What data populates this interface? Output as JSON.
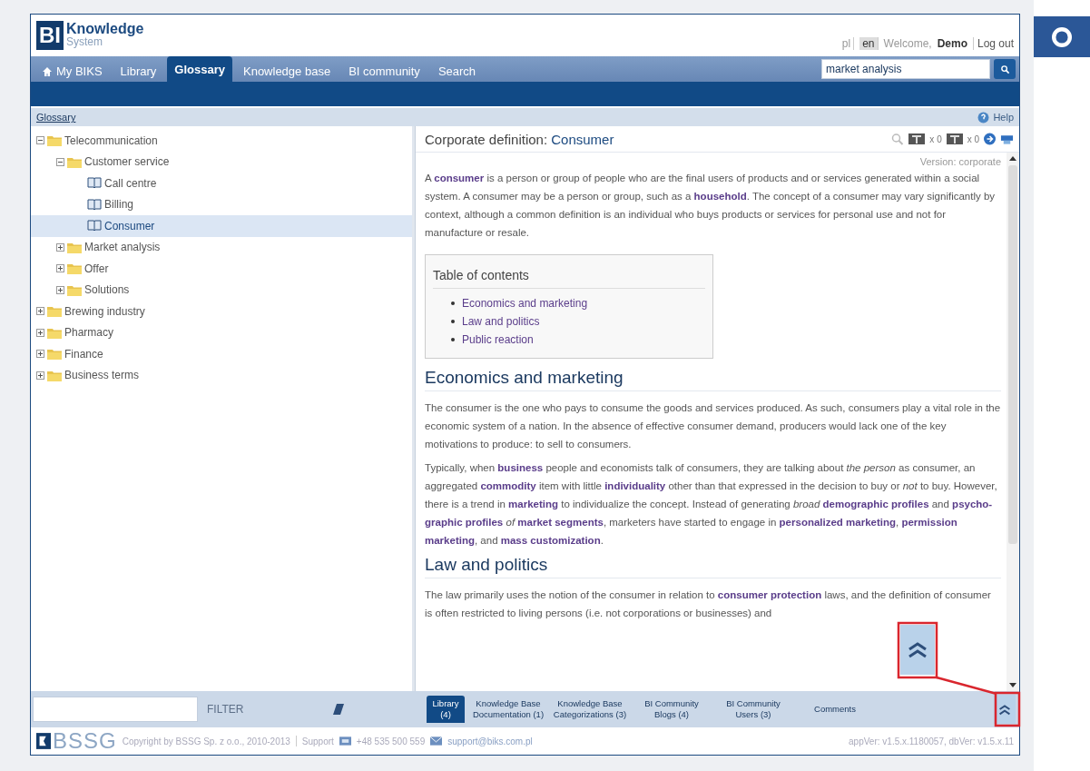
{
  "header": {
    "logo_mark": "BI",
    "logo_title": "Knowledge",
    "logo_subtitle": "System",
    "languages": [
      {
        "label": "pl",
        "selected": false
      },
      {
        "label": "en",
        "selected": true
      }
    ],
    "welcome": "Welcome,",
    "user": "Demo",
    "logout": "Log out"
  },
  "nav_tabs": [
    {
      "label": "My BIKS",
      "selected": false,
      "home": true
    },
    {
      "label": "Library",
      "selected": false
    },
    {
      "label": "Glossary",
      "selected": true
    },
    {
      "label": "Knowledge base",
      "selected": false
    },
    {
      "label": "BI community",
      "selected": false
    },
    {
      "label": "Search",
      "selected": false
    }
  ],
  "search": {
    "value": "market analysis"
  },
  "breadcrumb": "Glossary",
  "help": "Help",
  "tree": [
    {
      "label": "Telecommunication",
      "kind": "folder",
      "expanded": true,
      "selected": false,
      "children": [
        {
          "label": "Customer service",
          "kind": "folder",
          "expanded": true,
          "selected": false,
          "children": [
            {
              "label": "Call centre",
              "kind": "term",
              "selected": false
            },
            {
              "label": "Billing",
              "kind": "term",
              "selected": false
            },
            {
              "label": "Consumer",
              "kind": "term",
              "selected": true
            }
          ]
        },
        {
          "label": "Market analysis",
          "kind": "folder",
          "expanded": false,
          "selected": false
        },
        {
          "label": "Offer",
          "kind": "folder",
          "expanded": false,
          "selected": false
        },
        {
          "label": "Solutions",
          "kind": "folder",
          "expanded": false,
          "selected": false
        }
      ]
    },
    {
      "label": "Brewing industry",
      "kind": "folder",
      "expanded": false,
      "selected": false
    },
    {
      "label": "Pharmacy",
      "kind": "folder",
      "expanded": false,
      "selected": false
    },
    {
      "label": "Finance",
      "kind": "folder",
      "expanded": false,
      "selected": false
    },
    {
      "label": "Business terms",
      "kind": "folder",
      "expanded": false,
      "selected": false
    }
  ],
  "article": {
    "title_prefix": "Corporate definition:",
    "title": "Consumer",
    "counters": [
      "x 0",
      "x 0"
    ],
    "version": "Version: corporate",
    "intro": "A **consumer** is a person or group of people who are the final users of products and or services generated within a social system. A consumer may be a person or group, such as a **household**. The concept of a consumer may vary significantly by context, although a common definition is an individual who buys products or services for personal use and not for manufacture or resale.",
    "toc_title": "Table of contents",
    "toc": [
      "Economics and marketing",
      "Law and politics",
      "Public reaction"
    ],
    "sections": [
      {
        "heading": "Economics and marketing",
        "paragraphs": [
          "The consumer is the one who pays to consume the goods and services produced. As such, consumers play a vital role in the economic system of a nation. In the absence of effective consumer demand, producers would lack one of the key motivations to produce: to sell to consumers.",
          "Typically, when **business** people and economists talk of consumers, they are talking about *the person* as consumer, an aggregated **commodity** item with little **individuality** other than that expressed in the decision to buy or *not* to buy. However, there is a trend in **marketing** to individualize the concept. Instead of generating *broad* **demographic profiles** and **psycho-graphic profiles** *of* **market segments**, marketers have started to engage in **personalized marketing**, **permission marketing**, and **mass customization**."
        ]
      },
      {
        "heading": "Law and politics",
        "paragraphs": [
          "The law primarily uses the notion of the consumer in relation to **consumer protection** laws, and the definition of consumer is often restricted to living persons (i.e. not corporations or businesses) and"
        ]
      }
    ]
  },
  "filter": {
    "button": "FILTER"
  },
  "bottom_tabs": [
    {
      "label": "Library (4)",
      "selected": true
    },
    {
      "label": "Knowledge Base Documentation (1)",
      "selected": false
    },
    {
      "label": "Knowledge Base Categorizations (3)",
      "selected": false
    },
    {
      "label": "BI Community Blogs (4)",
      "selected": false
    },
    {
      "label": "BI Community Users (3)",
      "selected": false
    },
    {
      "label": "Comments",
      "selected": false
    }
  ],
  "footer": {
    "logo": "BSSG",
    "copyright": "Copyright by BSSG Sp. z o.o., 2010-2013",
    "support": "Support",
    "phone": "+48 535 500 559",
    "email": "support@biks.com.pl",
    "version": "appVer: v1.5.x.1180057, dbVer: v1.5.x.11"
  }
}
